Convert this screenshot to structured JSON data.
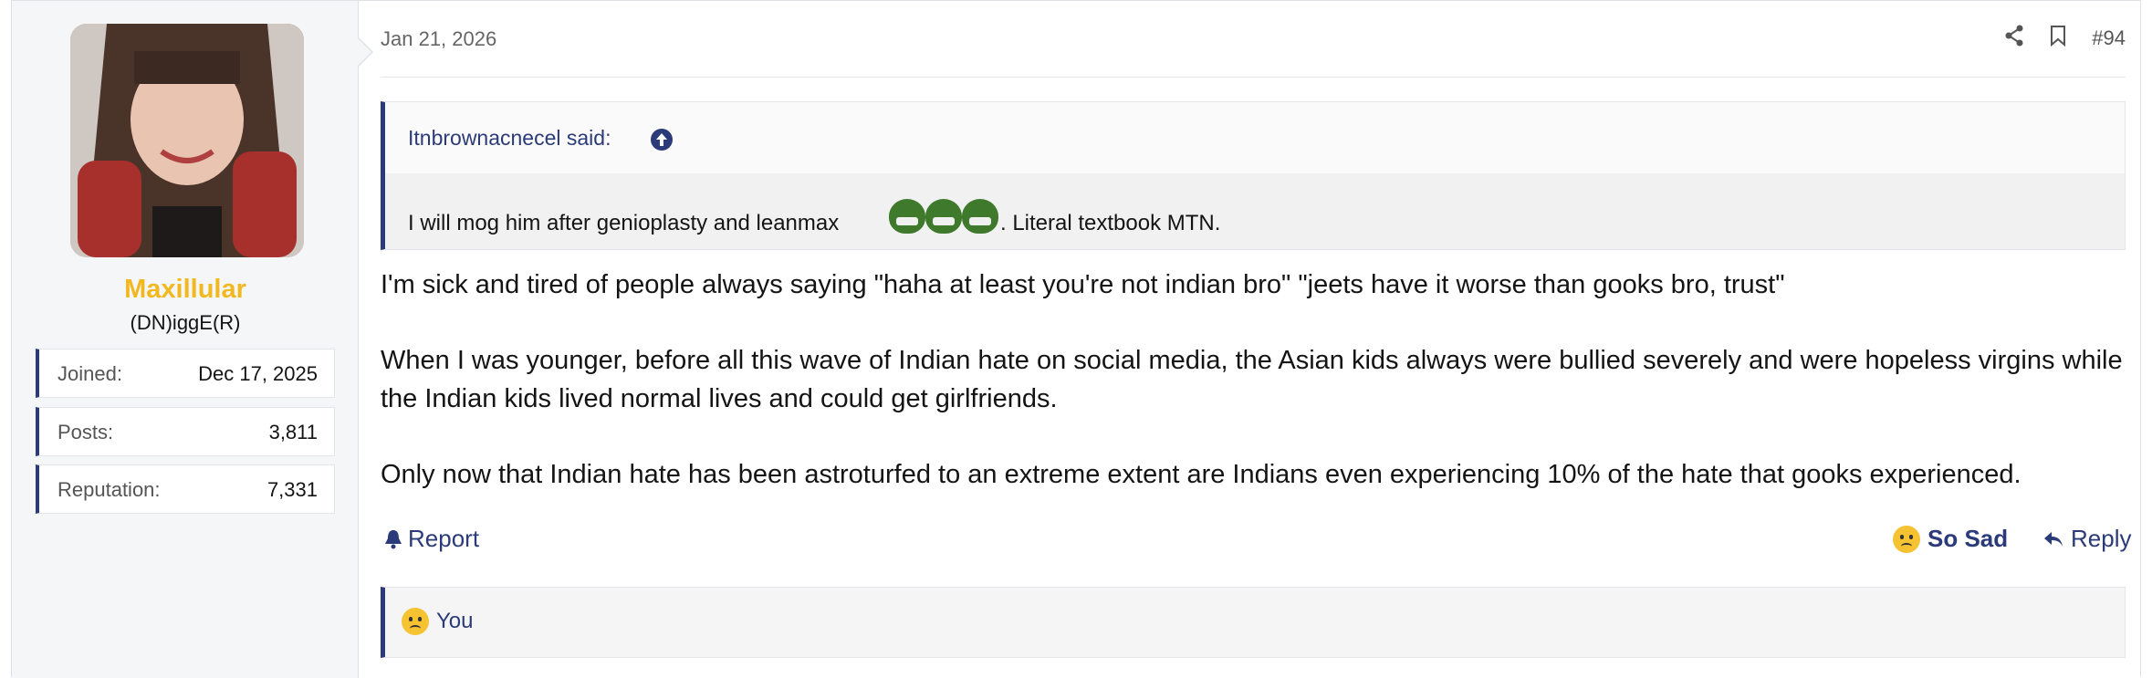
{
  "user": {
    "name": "Maxillular",
    "title": "(DN)iggE(R)",
    "stats": [
      {
        "label": "Joined:",
        "value": "Dec 17, 2025"
      },
      {
        "label": "Posts:",
        "value": "3,811"
      },
      {
        "label": "Reputation:",
        "value": "7,331"
      }
    ]
  },
  "post": {
    "date": "Jan 21, 2026",
    "number": "#94",
    "quote": {
      "author": "Itnbrownacnecel said:",
      "text_before": "I will mog him after genioplasty and leanmax",
      "text_after": ". Literal textbook MTN."
    },
    "paragraphs": [
      "I'm sick and tired of people always saying \"haha at least you're not indian bro\" \"jeets have it worse than gooks bro, trust\"",
      "When I was younger, before all this wave of Indian hate on social media, the Asian kids always were bullied severely and were hopeless virgins while the Indian kids lived normal lives and could get girlfriends.",
      "Only now that Indian hate has been astroturfed to an extreme extent are Indians even experiencing 10% of the hate that gooks experienced."
    ],
    "actions": {
      "report": "Report",
      "reaction": "So Sad",
      "reply": "Reply"
    },
    "reactions_summary": "You"
  },
  "icons": [
    "share-icon",
    "bookmark-icon",
    "arrow-up-circle-icon",
    "bell-icon",
    "reply-arrow-icon",
    "sad-face-icon",
    "frog-emoji-icon"
  ],
  "colors": {
    "accent": "#2b3a78",
    "username": "#f2b820"
  }
}
